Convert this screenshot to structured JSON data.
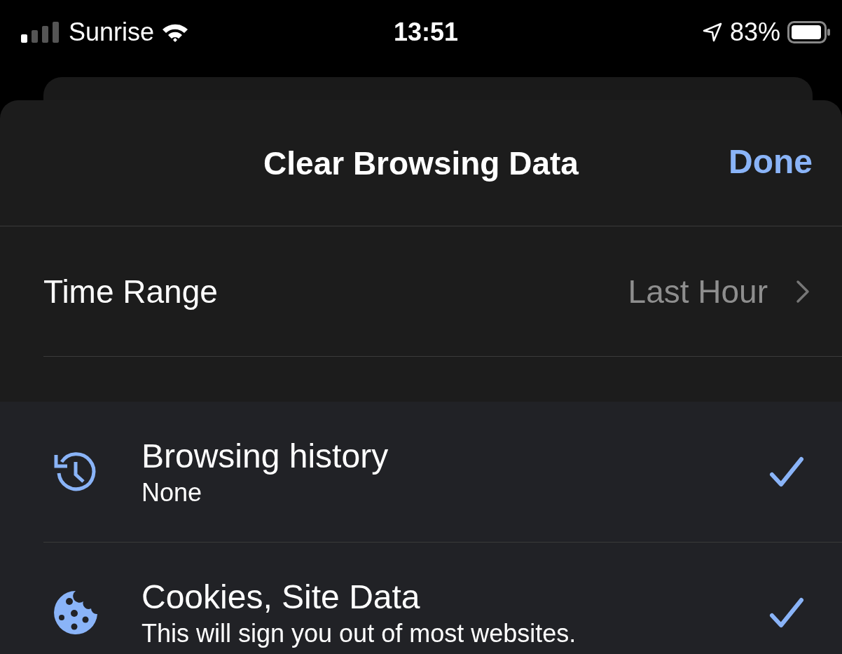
{
  "status_bar": {
    "carrier": "Sunrise",
    "time": "13:51",
    "battery": "83%"
  },
  "sheet": {
    "title": "Clear Browsing Data",
    "done": "Done"
  },
  "time_range": {
    "label": "Time Range",
    "value": "Last Hour"
  },
  "data_types": [
    {
      "kind": "history",
      "title": "Browsing history",
      "subtitle": "None",
      "checked": true
    },
    {
      "kind": "cookies",
      "title": "Cookies, Site Data",
      "subtitle": "This will sign you out of most websites.",
      "checked": true
    }
  ]
}
